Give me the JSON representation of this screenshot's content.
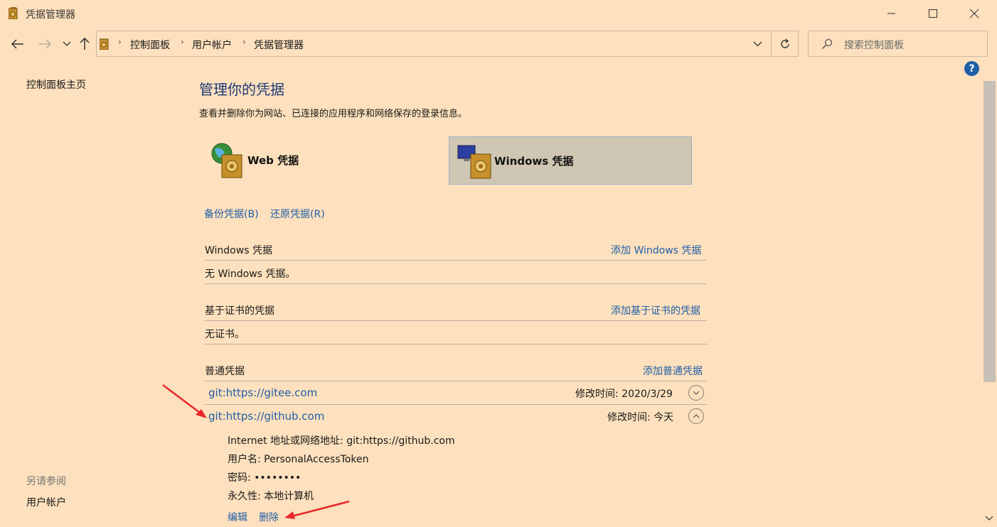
{
  "window": {
    "title": "凭据管理器"
  },
  "address": {
    "crumbs": [
      "控制面板",
      "用户帐户",
      "凭据管理器"
    ]
  },
  "search": {
    "placeholder": "搜索控制面板"
  },
  "sidebar": {
    "home": "控制面板主页",
    "see_also_title": "另请参阅",
    "see_also_link": "用户帐户"
  },
  "main": {
    "title": "管理你的凭据",
    "description": "查看并删除你为网站、已连接的应用程序和网络保存的登录信息。",
    "web_card": "Web 凭据",
    "windows_card": "Windows 凭据",
    "backup_link": "备份凭据(B)",
    "restore_link": "还原凭据(R)",
    "windows_section": {
      "title": "Windows 凭据",
      "add": "添加 Windows 凭据",
      "empty": "无 Windows 凭据。"
    },
    "cert_section": {
      "title": "基于证书的凭据",
      "add": "添加基于证书的凭据",
      "empty": "无证书。"
    },
    "generic_section": {
      "title": "普通凭据",
      "add": "添加普通凭据",
      "items": [
        {
          "name": "git:https://gitee.com",
          "modified": "修改时间:  2020/3/29"
        },
        {
          "name": "git:https://github.com",
          "modified": "修改时间:  今天"
        }
      ],
      "details": {
        "address": "Internet 地址或网络地址:  git:https://github.com",
        "username": "用户名:  PersonalAccessToken",
        "password": "密码:  ••••••••",
        "persistence": "永久性:  本地计算机",
        "edit": "编辑",
        "delete": "删除"
      }
    }
  },
  "help_label": "?",
  "colors": {
    "background": "#fde0bd",
    "link": "#1f5fa8",
    "title": "#1e3a78",
    "selected_card": "#cfc7b3",
    "annotation_arrow": "#e8282b"
  }
}
